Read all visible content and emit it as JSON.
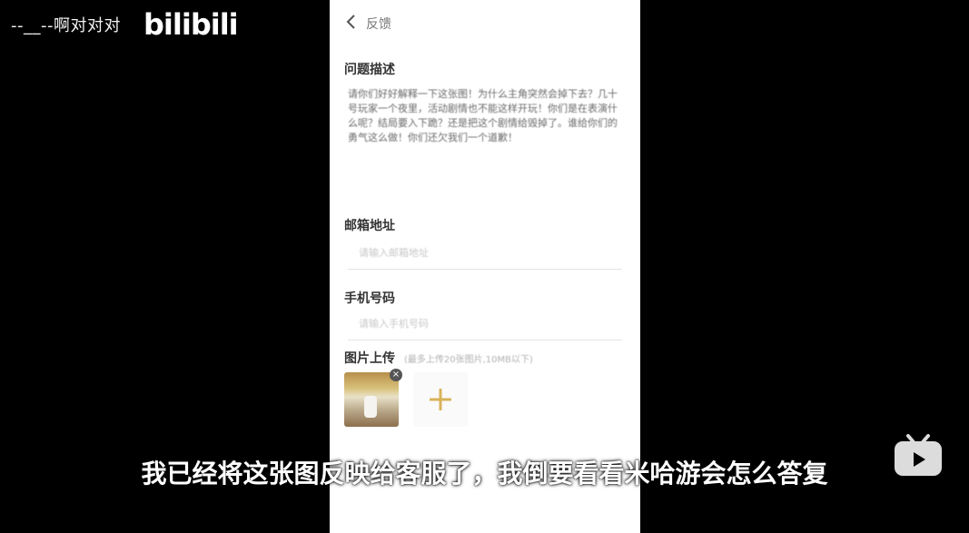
{
  "overlay": {
    "watermark": "--__--啊对对对",
    "bili_logo": "bilibili",
    "subtitle": "我已经将这张图反映给客服了，我倒要看看米哈游会怎么答复"
  },
  "form": {
    "nav_title": "反馈",
    "description_label": "问题描述",
    "description_text": "请你们好好解释一下这张图！为什么主角突然会掉下去？几十号玩家一个夜里，活动剧情也不能这样开玩！你们是在表演什么呢？结局要入下跪？还是把这个剧情给毁掉了。谁给你们的勇气这么做！你们还欠我们一个道歉！",
    "email_label": "邮箱地址",
    "email_placeholder": "请输入邮箱地址",
    "phone_label": "手机号码",
    "phone_placeholder": "请输入手机号码",
    "upload_label": "图片上传",
    "upload_hint": "(最多上传20张图片,10MB以下)"
  },
  "colors": {
    "background": "#000000",
    "page": "#ffffff",
    "add_accent": "#d9b35a",
    "subtitle_text": "#ffffff"
  },
  "icons": {
    "back": "chevron-left-icon",
    "remove": "close-icon",
    "add": "plus-icon",
    "tv": "bilibili-tv-icon"
  }
}
